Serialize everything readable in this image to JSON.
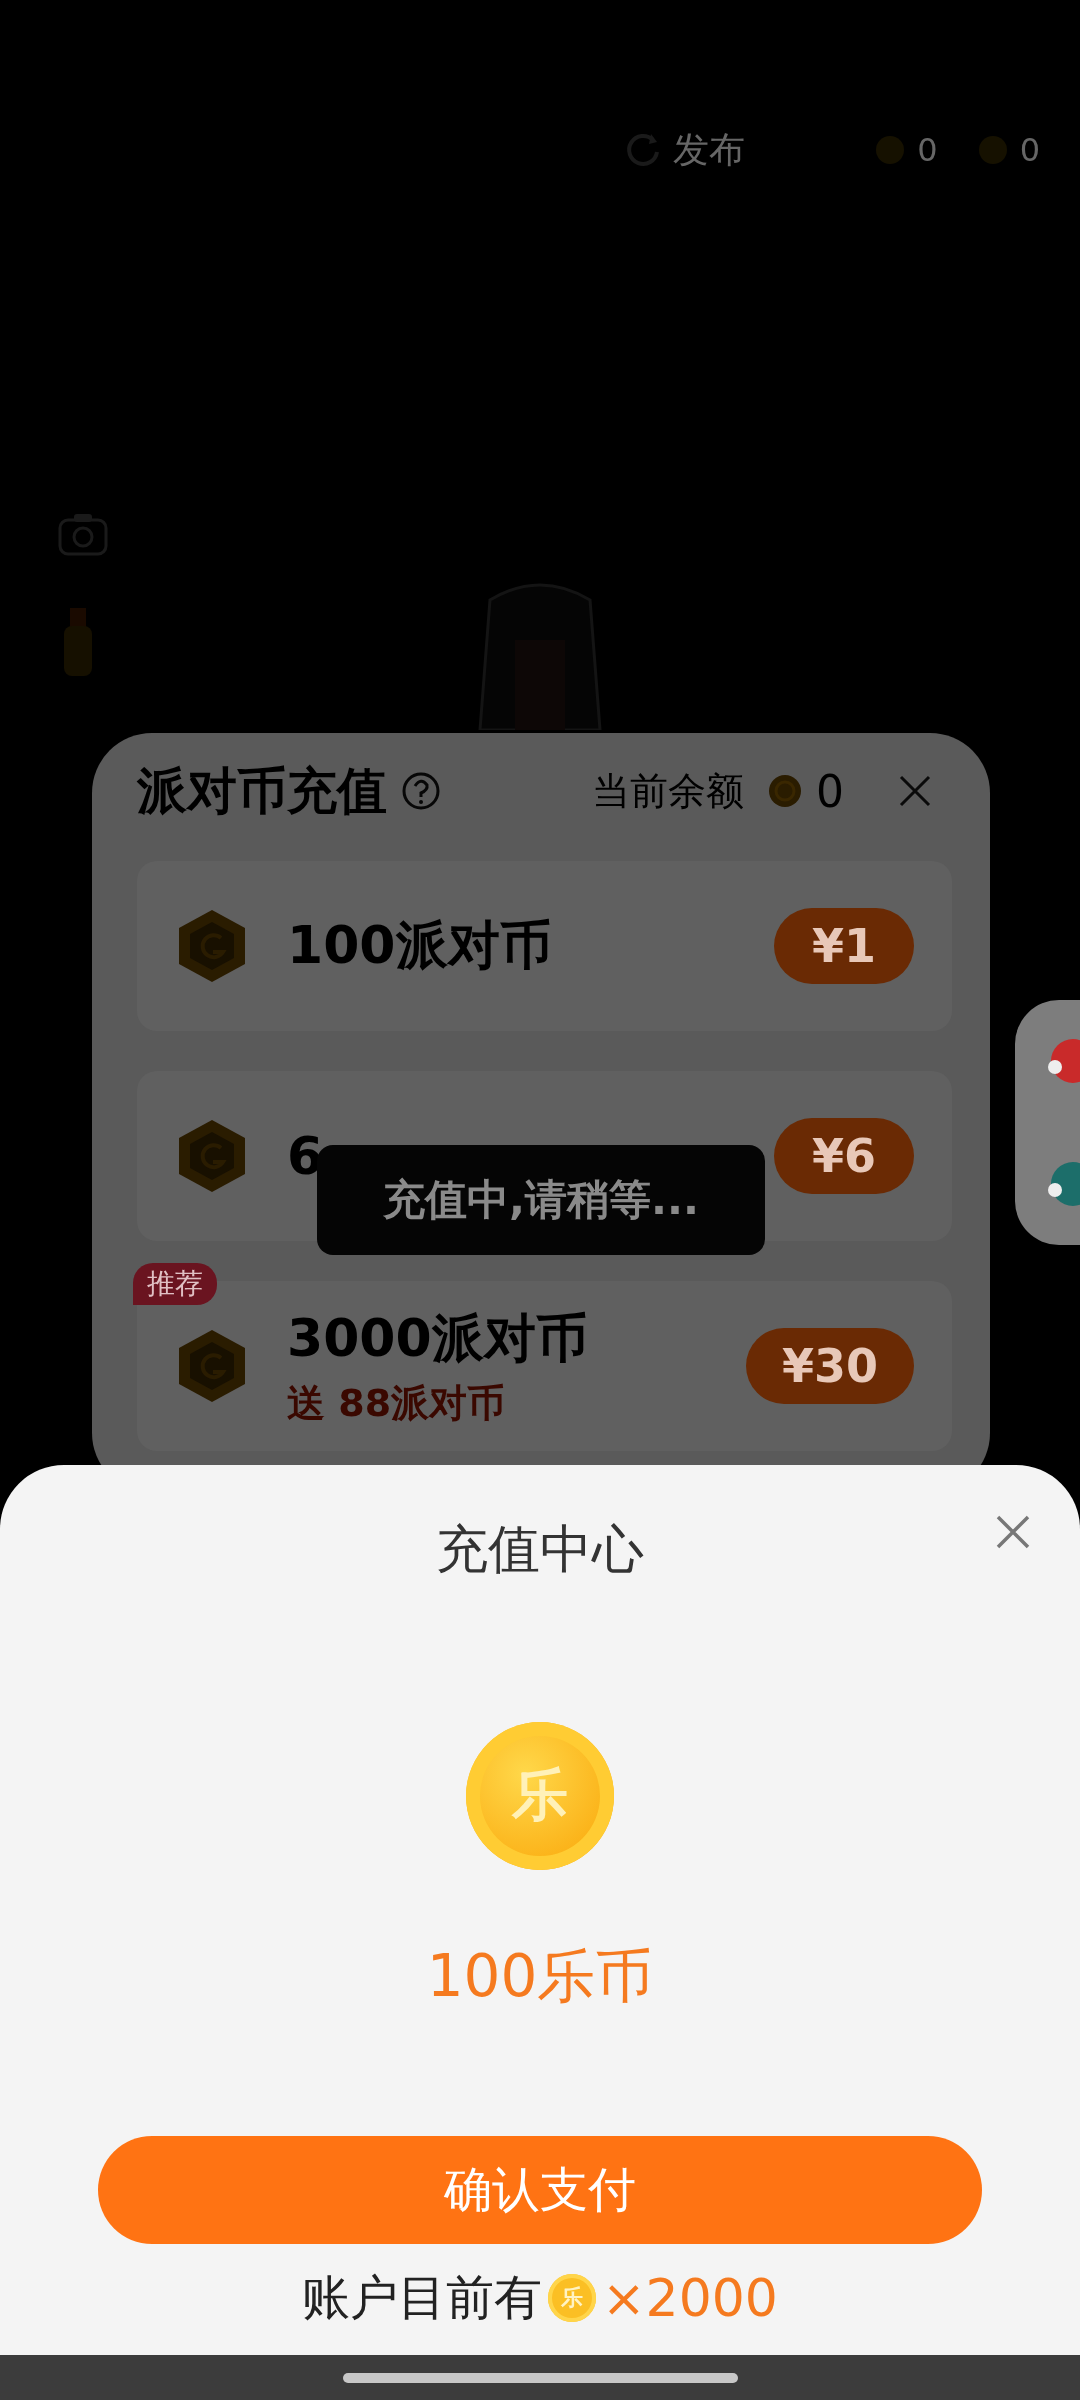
{
  "top_bar": {
    "publish_label": "发布",
    "counters": [
      "0",
      "0"
    ]
  },
  "party_dialog": {
    "title": "派对币充值",
    "balance_label": "当前余额",
    "balance": "0",
    "packages": [
      {
        "name": "100派对币",
        "price": "¥1"
      },
      {
        "name": "6",
        "price": "¥6"
      },
      {
        "name": "3000派对币",
        "bonus": "送 88派对币",
        "badge": "推荐",
        "price": "¥30"
      }
    ]
  },
  "toast": "充值中,请稍等...",
  "sheet": {
    "title": "充值中心",
    "coin_glyph": "乐",
    "amount": "100乐币",
    "confirm": "确认支付",
    "balance_prefix": "账户目前有",
    "balance_coin_glyph": "乐",
    "balance_value": "×2000"
  }
}
